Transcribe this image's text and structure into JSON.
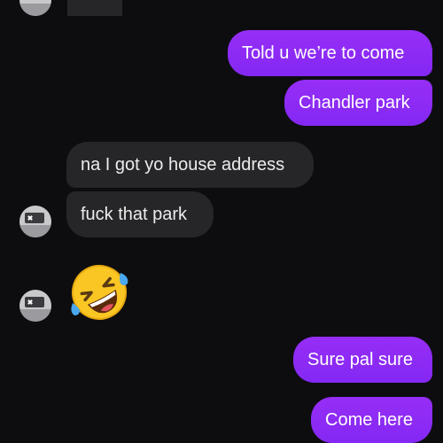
{
  "messages": [
    {
      "direction": "outgoing",
      "text": "Told u we’re to come"
    },
    {
      "direction": "outgoing",
      "text": "Chandler park"
    },
    {
      "direction": "incoming",
      "text": "na I got yo house address"
    },
    {
      "direction": "incoming",
      "text": "fuck that park"
    },
    {
      "direction": "incoming",
      "emoji": "rolling-on-the-floor-laughing"
    },
    {
      "direction": "outgoing",
      "text": "Sure pal sure"
    },
    {
      "direction": "outgoing",
      "text": "Come here"
    }
  ],
  "colors": {
    "background": "#0d0d10",
    "outgoing_bubble": "#8b2cf5",
    "incoming_bubble": "#262629",
    "text": "#ffffff"
  }
}
